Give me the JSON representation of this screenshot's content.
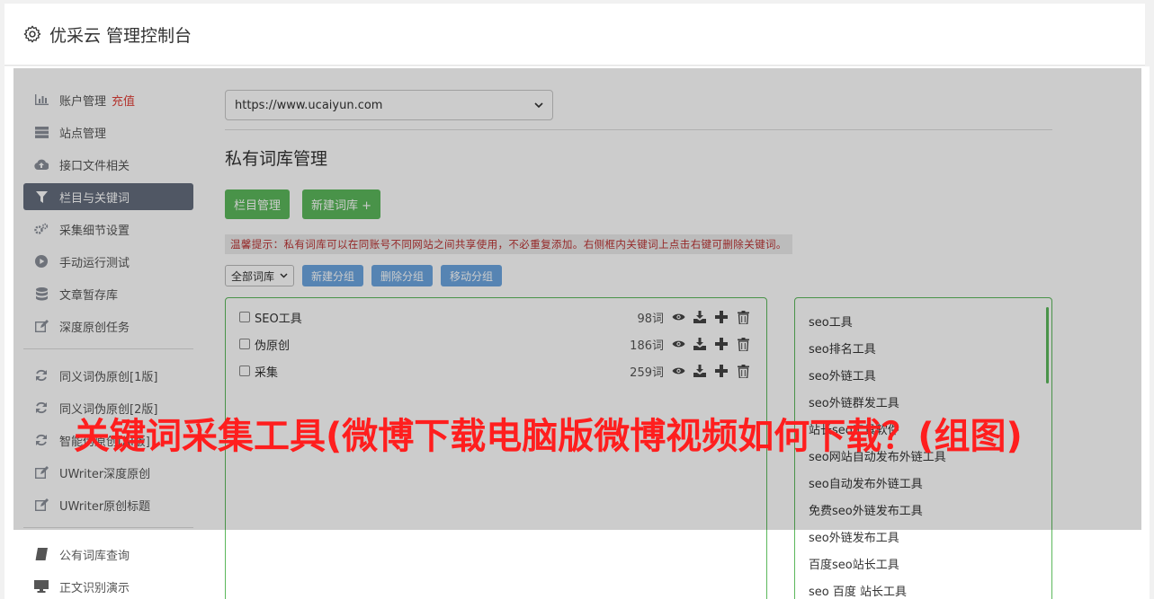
{
  "app": {
    "title": "优采云 管理控制台",
    "icon": "gear-icon"
  },
  "sidebar": {
    "items": [
      {
        "label": "账户管理",
        "extra": "充值",
        "icon": "bar-chart-icon"
      },
      {
        "label": "站点管理",
        "icon": "server-icon"
      },
      {
        "label": "接口文件相关",
        "icon": "cloud-upload-icon"
      },
      {
        "label": "栏目与关键词",
        "icon": "filter-icon",
        "active": true
      },
      {
        "label": "采集细节设置",
        "icon": "cogs-icon"
      },
      {
        "label": "手动运行测试",
        "icon": "play-circle-icon"
      },
      {
        "label": "文章暂存库",
        "icon": "database-icon"
      },
      {
        "label": "深度原创任务",
        "icon": "edit-icon"
      }
    ],
    "items2": [
      {
        "label": "同义词伪原创[1版]",
        "icon": "refresh-icon"
      },
      {
        "label": "同义词伪原创[2版]",
        "icon": "refresh-icon"
      },
      {
        "label": "智能伪原创[AI版]",
        "icon": "refresh-icon"
      },
      {
        "label": "UWriter深度原创",
        "icon": "edit-icon"
      },
      {
        "label": "UWriter原创标题",
        "icon": "edit-icon"
      }
    ],
    "items3": [
      {
        "label": "公有词库查询",
        "icon": "book-icon"
      },
      {
        "label": "正文识别演示",
        "icon": "monitor-icon"
      }
    ]
  },
  "main": {
    "site_select": "https://www.ucaiyun.com",
    "page_title": "私有词库管理",
    "btn_columns": "栏目管理",
    "btn_new_lib": "新建词库 +",
    "tip": "温馨提示：私有词库可以在同账号不同网站之间共享使用，不必重复添加。右侧框内关键词上点击右键可删除关键词。",
    "group_select": "全部词库",
    "btn_new_group": "新建分组",
    "btn_delete_group": "删除分组",
    "btn_move_group": "移动分组",
    "libraries": [
      {
        "name": "SEO工具",
        "count": "98词"
      },
      {
        "name": "伪原创",
        "count": "186词"
      },
      {
        "name": "采集",
        "count": "259词"
      }
    ],
    "keywords": [
      "seo工具",
      "seo排名工具",
      "seo外链工具",
      "seo外链群发工具",
      "站长seo工具软件",
      "seo网站自动发布外链工具",
      "seo自动发布外链工具",
      "免费seo外链发布工具",
      "seo外链发布工具",
      "百度seo站长工具",
      "seo 百度 站长工具"
    ]
  },
  "headline": "关键词采集工具(微博下载电脑版微博视频如何下载？(组图)"
}
